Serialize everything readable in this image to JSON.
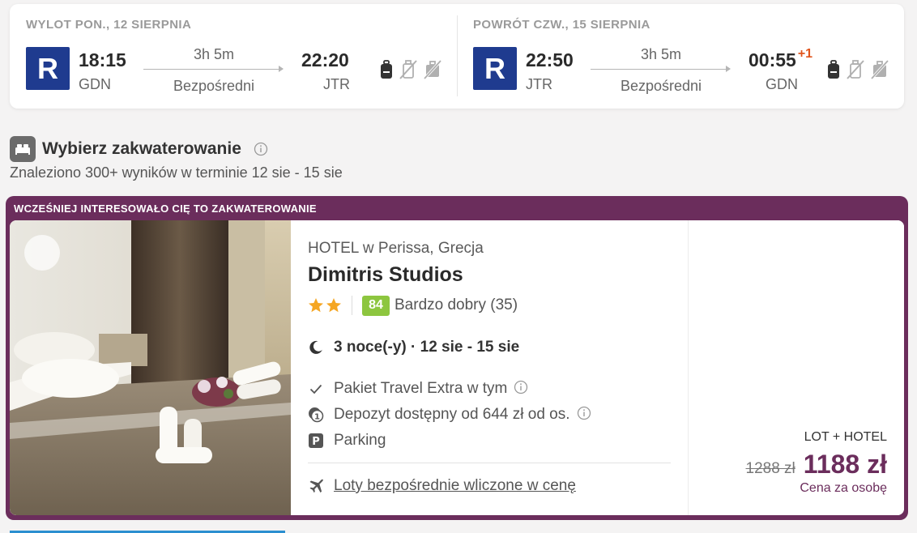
{
  "outbound": {
    "header": "WYLOT PON., 12 SIERPNIA",
    "airline_code": "R",
    "dep_time": "18:15",
    "dep_code": "GDN",
    "duration": "3h 5m",
    "stops": "Bezpośredni",
    "arr_time": "22:20",
    "arr_code": "JTR"
  },
  "return": {
    "header": "POWRÓT CZW., 15 SIERPNIA",
    "airline_code": "R",
    "dep_time": "22:50",
    "dep_code": "JTR",
    "duration": "3h 5m",
    "stops": "Bezpośredni",
    "arr_time": "00:55",
    "arr_day_offset": "+1",
    "arr_code": "GDN"
  },
  "accommodation": {
    "title": "Wybierz zakwaterowanie",
    "subtitle": "Znaleziono 300+ wyników w terminie 12 sie - 15 sie"
  },
  "hotel": {
    "badge": "WCZEŚNIEJ INTERESOWAŁO CIĘ TO ZAKWATEROWANIE",
    "type_location": "HOTEL w Perissa, Grecja",
    "name": "Dimitris Studios",
    "stars": 2,
    "score": "84",
    "score_text": "Bardzo dobry (35)",
    "stay": "3 noce(-y) · 12 sie - 15 sie",
    "features": [
      "Pakiet Travel Extra w tym",
      "Depozyt dostępny od 644 zł od os.",
      "Parking"
    ],
    "flights_included": "Loty bezpośrednie wliczone w cenę",
    "package_label": "LOT + HOTEL",
    "old_price": "1288 zł",
    "price": "1188 zł",
    "price_note": "Cena za osobę"
  },
  "colors": {
    "airline": "#1f3b8f",
    "accent_purple": "#6b2d5c",
    "score_green": "#8dc63f",
    "star": "#f5a623",
    "day_offset": "#e0541c"
  }
}
